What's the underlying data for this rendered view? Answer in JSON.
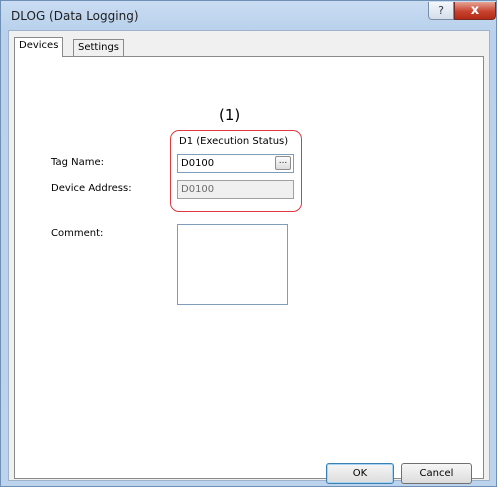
{
  "window": {
    "title": "DLOG (Data Logging)"
  },
  "titlebar_buttons": {
    "help": "?",
    "close": "x"
  },
  "tabs": [
    {
      "label": "Devices",
      "active": true
    },
    {
      "label": "Settings",
      "active": false
    }
  ],
  "callout_number": "(1)",
  "section": {
    "header": "D1 (Execution Status)"
  },
  "fields": {
    "tag_name": {
      "label": "Tag Name:",
      "value": "D0100",
      "browse_label": "..."
    },
    "device_address": {
      "label": "Device Address:",
      "value": "D0100"
    },
    "comment": {
      "label": "Comment:",
      "value": ""
    }
  },
  "buttons": {
    "ok": "OK",
    "cancel": "Cancel"
  },
  "colors": {
    "highlight": "#e0393f",
    "close_button": "#c7432f"
  }
}
